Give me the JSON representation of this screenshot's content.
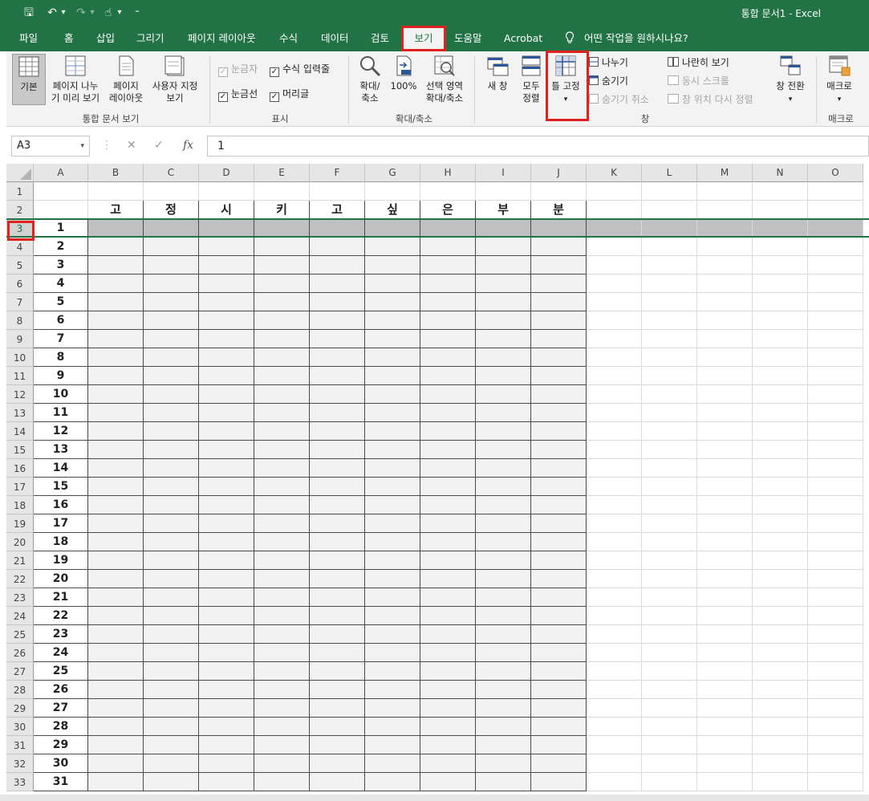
{
  "window": {
    "title": "통합 문서1  -  Excel"
  },
  "qat": {
    "save": "🖫",
    "undo": "↶",
    "undo_dd": "▾",
    "redo": "↷",
    "redo_dd": "▾",
    "touch": "☝",
    "touch_dd": "▾",
    "more": "⁼"
  },
  "tabs": [
    "파일",
    "홈",
    "삽입",
    "그리기",
    "페이지 레이아웃",
    "수식",
    "데이터",
    "검토",
    "보기",
    "도움말",
    "Acrobat"
  ],
  "active_tab": "보기",
  "tell_me": "어떤 작업을 원하시나요?",
  "ribbon": {
    "workbook_views": {
      "label": "통합 문서 보기",
      "normal": "기본",
      "page_break_1": "페이지 나누",
      "page_break_2": "기 미리 보기",
      "page_layout_1": "페이지",
      "page_layout_2": "레이아웃",
      "custom_1": "사용자 지정",
      "custom_2": "보기"
    },
    "show": {
      "label": "표시",
      "ruler": "눈금자",
      "formula_bar": "수식 입력줄",
      "gridlines": "눈금선",
      "headings": "머리글"
    },
    "zoom": {
      "label": "확대/축소",
      "zoom_1": "확대/",
      "zoom_2": "축소",
      "hundred": "100%",
      "selection_1": "선택 영역",
      "selection_2": "확대/축소"
    },
    "window": {
      "label": "창",
      "new_window": "새 창",
      "arrange_1": "모두",
      "arrange_2": "정렬",
      "freeze": "틀 고정",
      "split": "나누기",
      "hide": "숨기기",
      "unhide": "숨기기 취소",
      "side_by_side": "나란히 보기",
      "sync_scroll": "동시 스크롤",
      "reset_pos": "창 위치 다시 정렬",
      "switch": "창 전환"
    },
    "macros": {
      "label": "매크로",
      "macros_btn": "매크로"
    }
  },
  "formula_bar": {
    "name_box": "A3",
    "cancel": "✕",
    "enter": "✓",
    "fx": "fx",
    "value": "1"
  },
  "columns": [
    "A",
    "B",
    "C",
    "D",
    "E",
    "F",
    "G",
    "H",
    "I",
    "J",
    "K",
    "L",
    "M",
    "N",
    "O"
  ],
  "row_numbers": [
    "1",
    "2",
    "3",
    "4",
    "5",
    "6",
    "7",
    "8",
    "9",
    "10",
    "11",
    "12",
    "13",
    "14",
    "15",
    "16",
    "17",
    "18",
    "19",
    "20",
    "21",
    "22",
    "23",
    "24",
    "25",
    "26",
    "27",
    "28",
    "29",
    "30",
    "31",
    "32",
    "33"
  ],
  "header_row": [
    "고",
    "정",
    "시",
    "키",
    "고",
    "싶",
    "은",
    "부",
    "분"
  ],
  "a_values": [
    "1",
    "2",
    "3",
    "4",
    "5",
    "6",
    "7",
    "8",
    "9",
    "10",
    "11",
    "12",
    "13",
    "14",
    "15",
    "16",
    "17",
    "18",
    "19",
    "20",
    "21",
    "22",
    "23",
    "24",
    "25",
    "26",
    "27",
    "28",
    "29",
    "30",
    "31"
  ],
  "colors": {
    "accent": "#217346",
    "highlight": "#e0221f"
  }
}
